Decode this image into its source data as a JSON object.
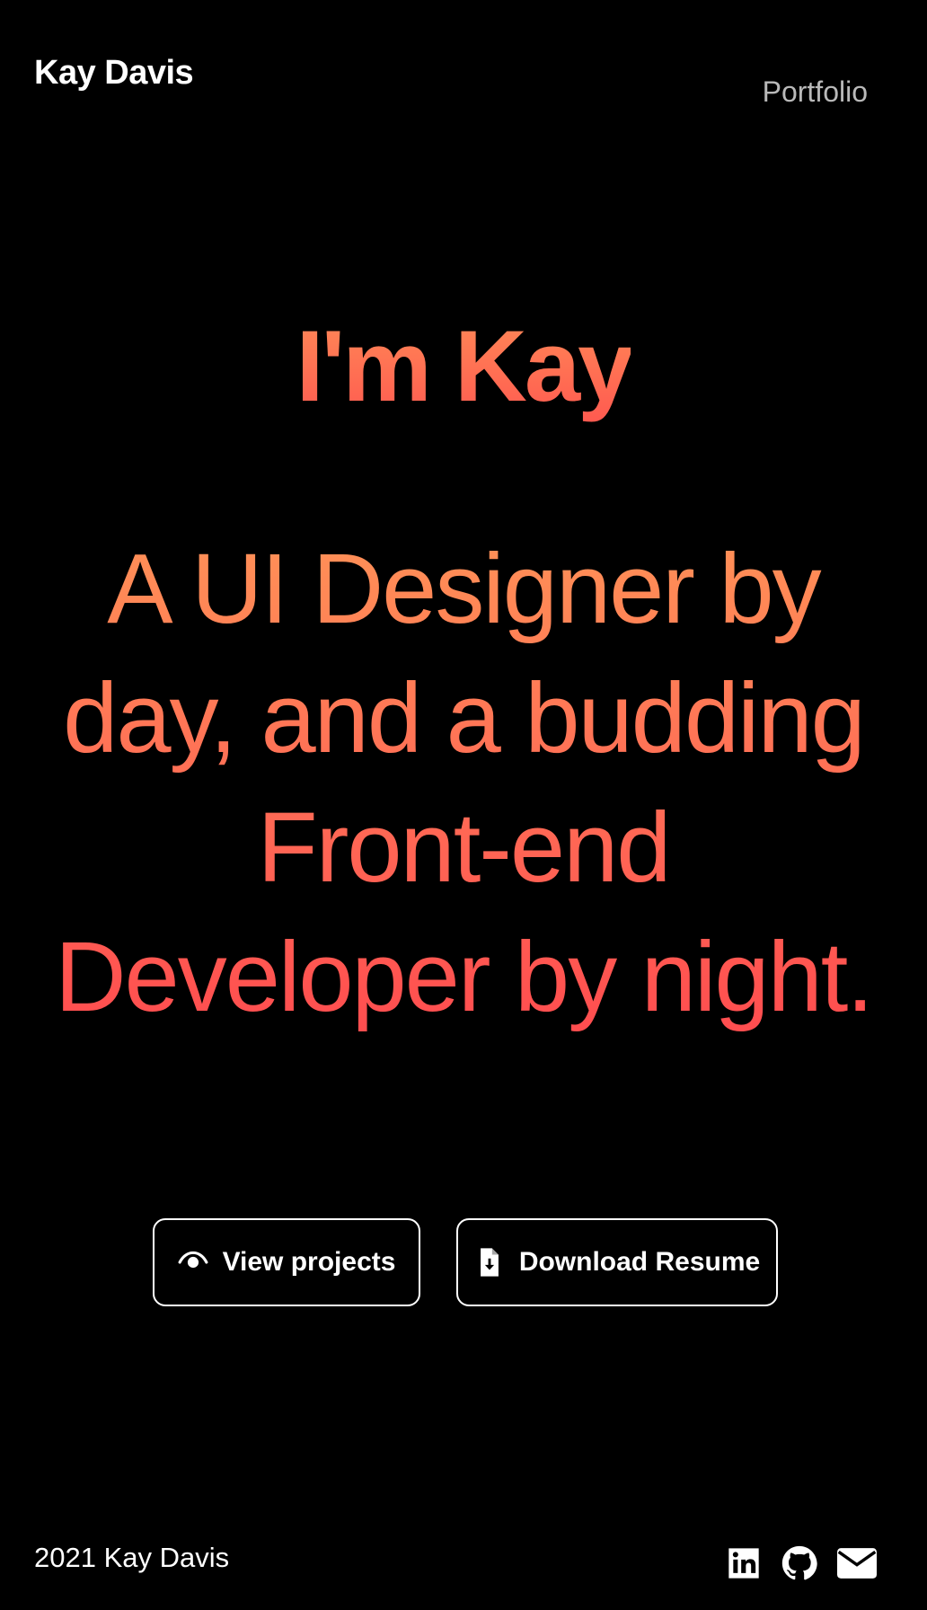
{
  "header": {
    "brand": "Kay Davis",
    "nav_portfolio": "Portfolio"
  },
  "hero": {
    "title": "I'm Kay",
    "subtitle": "A UI Designer by day, and a budding Front-end Developer by night."
  },
  "buttons": {
    "view_projects": "View projects",
    "view_projects_icon": "eye-icon",
    "download_resume": "Download Resume",
    "download_resume_icon": "file-download-icon"
  },
  "footer": {
    "copyright": "2021 Kay Davis",
    "social_icons": [
      "linkedin-icon",
      "github-icon",
      "envelope-icon"
    ]
  },
  "colors": {
    "background": "#000000",
    "accent_top": "#ff8a57",
    "accent_bottom": "#ff4c4f",
    "nav_link": "#b9b9b9"
  }
}
